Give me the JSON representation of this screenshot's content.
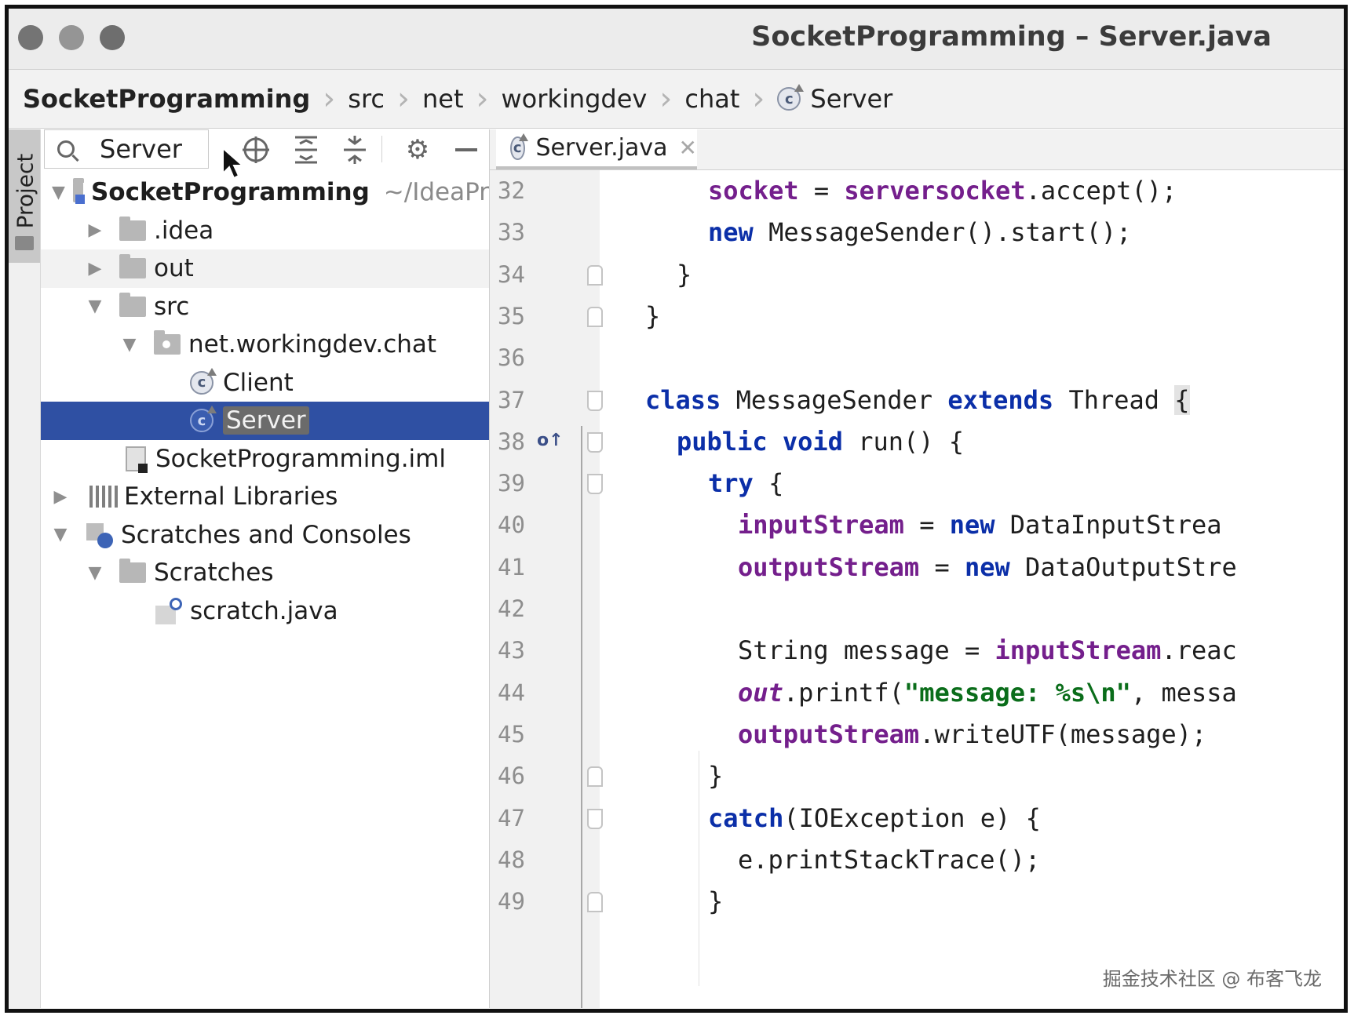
{
  "window": {
    "title": "SocketProgramming – Server.java"
  },
  "breadcrumb": {
    "items": [
      "SocketProgramming",
      "src",
      "net",
      "workingdev",
      "chat",
      "Server"
    ]
  },
  "sidebar_tab": {
    "label": "Project"
  },
  "project_panel": {
    "search_value": "Server",
    "toolbar_icons": [
      "locate-icon",
      "expand-all-icon",
      "collapse-all-icon",
      "gear-icon",
      "hide-icon"
    ],
    "tree": [
      {
        "label": "SocketProgramming",
        "hint": "~/IdeaPr",
        "icon": "module-folder-icon",
        "expanded": true,
        "depth": 0
      },
      {
        "label": ".idea",
        "icon": "folder-icon",
        "expanded": false,
        "depth": 1
      },
      {
        "label": "out",
        "icon": "folder-icon",
        "expanded": false,
        "depth": 1
      },
      {
        "label": "src",
        "icon": "folder-icon",
        "expanded": true,
        "depth": 1
      },
      {
        "label": "net.workingdev.chat",
        "icon": "package-icon",
        "expanded": true,
        "depth": 2
      },
      {
        "label": "Client",
        "icon": "class-icon",
        "depth": 3
      },
      {
        "label": "Server",
        "icon": "class-icon",
        "depth": 3,
        "selected": true
      },
      {
        "label": "SocketProgramming.iml",
        "icon": "iml-file-icon",
        "depth": 2
      },
      {
        "label": "External Libraries",
        "icon": "library-icon",
        "expanded": false,
        "depth": 0
      },
      {
        "label": "Scratches and Consoles",
        "icon": "scratches-icon",
        "expanded": true,
        "depth": 0
      },
      {
        "label": "Scratches",
        "icon": "folder-icon",
        "expanded": true,
        "depth": 1
      },
      {
        "label": "scratch.java",
        "icon": "java-scratch-icon",
        "depth": 2
      }
    ]
  },
  "editor": {
    "tab_title": "Server.java",
    "line_numbers": [
      "32",
      "33",
      "34",
      "35",
      "36",
      "37",
      "38",
      "39",
      "40",
      "41",
      "42",
      "43",
      "44",
      "45",
      "46",
      "47",
      "48",
      "49"
    ],
    "code_lines": [
      "socket = serversocket.accept();",
      "new MessageSender().start();",
      "}",
      "}",
      "",
      "class MessageSender extends Thread {",
      "public void run() {",
      "try {",
      "inputStream = new DataInputStrea",
      "outputStream = new DataOutputStre",
      "",
      "String message = inputStream.reac",
      "out.printf(\"message: %s\\n\", messa",
      "outputStream.writeUTF(message);",
      "}",
      "catch(IOException e) {",
      "e.printStackTrace();",
      "}"
    ]
  },
  "watermark": "掘金技术社区 @ 布客飞龙",
  "colors": {
    "selection": "#2f50a3",
    "keyword": "#0b2fa8",
    "field": "#741f8c",
    "string": "#0a6d1a"
  }
}
